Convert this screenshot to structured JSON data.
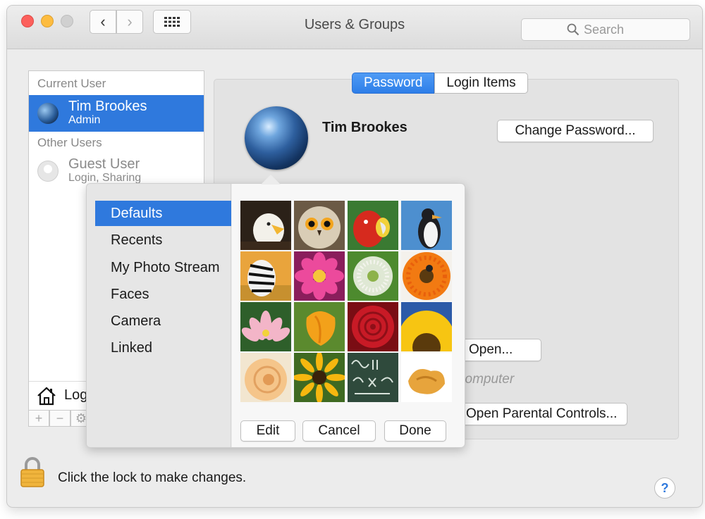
{
  "window": {
    "title": "Users & Groups",
    "search_placeholder": "Search"
  },
  "sidebar": {
    "current_user_header": "Current User",
    "current_user": {
      "name": "Tim Brookes",
      "role": "Admin"
    },
    "other_users_header": "Other Users",
    "guest_user": {
      "name": "Guest User",
      "role": "Login, Sharing"
    },
    "login_label": "Login Options",
    "controls": [
      "+",
      "−",
      "⚙"
    ]
  },
  "tabs": {
    "active": "Password",
    "inactive": "Login Items"
  },
  "main": {
    "user_name": "Tim Brookes",
    "change_password": "Change Password...",
    "open_button": "Open...",
    "computer_text": "computer",
    "parental_controls": "Open Parental Controls..."
  },
  "popover": {
    "categories": [
      "Defaults",
      "Recents",
      "My Photo Stream",
      "Faces",
      "Camera",
      "Linked"
    ],
    "selected_category": "Defaults",
    "images": [
      "eagle",
      "owl",
      "parrot",
      "penguin",
      "zebra",
      "pink-flower",
      "dandelion",
      "orange-flower",
      "lotus",
      "orange-tulip",
      "red-rose",
      "sunflower",
      "yellow-rose",
      "black-eyed-susan",
      "chalkboard",
      "fortune-cookie"
    ],
    "edit": "Edit",
    "cancel": "Cancel",
    "done": "Done"
  },
  "footer": {
    "lock_text": "Click the lock to make changes.",
    "help": "?"
  },
  "colors": {
    "accent": "#2f79dd",
    "traffic_red": "#fc605c",
    "traffic_yellow": "#fdbc40"
  }
}
